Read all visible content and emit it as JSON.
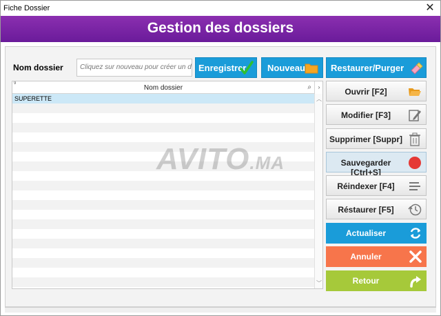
{
  "window": {
    "title": "Fiche Dossier",
    "close_symbol": "✕"
  },
  "banner": {
    "heading": "Gestion des dossiers"
  },
  "form": {
    "name_label": "Nom dossier",
    "name_input_placeholder": "Cliquez sur nouveau pour créer un do"
  },
  "top_buttons": {
    "save": "Enregistrer",
    "new": "Nouveau",
    "restore_purge": "Restaurer/Purger"
  },
  "grid": {
    "corner_marker": "9",
    "column_header": "Nom dossier",
    "search_icon": "⌕",
    "side_marker": "›",
    "rows": [
      "SUPERETTE",
      "",
      "",
      "",
      "",
      "",
      "",
      "",
      "",
      "",
      "",
      "",
      "",
      "",
      "",
      "",
      "",
      "",
      "",
      ""
    ],
    "selected_row": 0
  },
  "watermark": {
    "text": "AVITO",
    "suffix": ".MA"
  },
  "side_buttons": {
    "open": "Ouvrir [F2]",
    "modify": "Modifier [F3]",
    "delete": "Supprimer [Suppr]",
    "save_ctrl": "Sauvegarder [Ctrl+S]",
    "reindex": "Réindexer [F4]",
    "restore": "Réstaurer [F5]",
    "refresh": "Actualiser",
    "cancel": "Annuler",
    "back": "Retour"
  },
  "icons": {
    "check": "check-icon",
    "folder": "folder-icon",
    "eraser": "eraser-icon",
    "open_folder": "folder-open-icon",
    "edit": "edit-icon",
    "trash": "trash-icon",
    "record": "record-icon",
    "reindex": "list-icon",
    "history": "history-icon",
    "refresh": "refresh-icon",
    "cancel": "x-icon",
    "back": "back-arrow-icon"
  },
  "colors": {
    "banner": "#7b22a6",
    "primary_blue": "#1a9cd9",
    "cancel_orange": "#f7754b",
    "back_green": "#a6c93a",
    "record_red": "#e53935",
    "check_green": "#2fbf2f",
    "folder_yellow": "#f5a623"
  }
}
